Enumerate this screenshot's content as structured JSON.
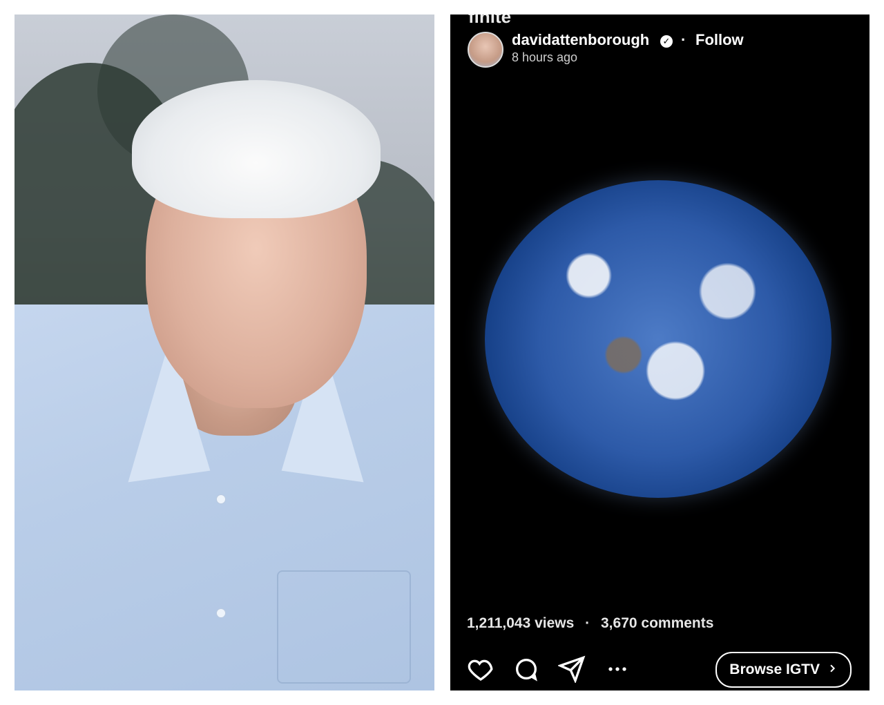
{
  "left_panel": {
    "image_kind": "portrait-photo"
  },
  "post": {
    "cut_text": "finite",
    "username": "davidattenborough",
    "verified_icon": "verified-badge-icon",
    "separator": "·",
    "follow_label": "Follow",
    "time_ago": "8 hours ago",
    "media_kind": "earth-photo",
    "stats": {
      "views": "1,211,043 views",
      "separator": "·",
      "comments": "3,670 comments"
    },
    "actions": {
      "like_icon": "heart-icon",
      "comment_icon": "comment-bubble-icon",
      "share_icon": "send-icon",
      "more_icon": "more-dots-icon",
      "browse_label": "Browse IGTV",
      "browse_chevron_icon": "chevron-right-icon"
    }
  },
  "colors": {
    "panel_bg": "#000000",
    "text_primary": "#ffffff",
    "text_secondary": "#cfcfcf"
  }
}
